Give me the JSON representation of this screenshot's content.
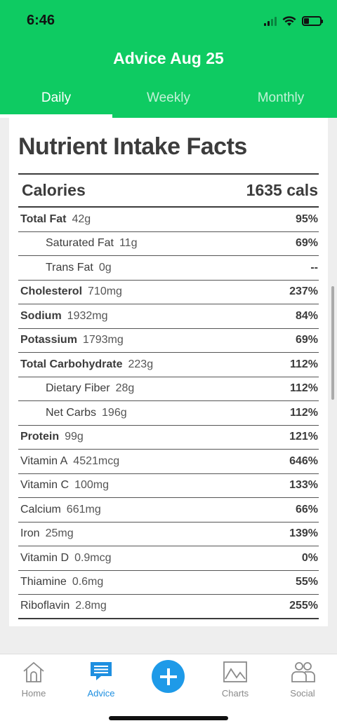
{
  "status": {
    "time": "6:46"
  },
  "header": {
    "title": "Advice Aug 25",
    "tabs": [
      {
        "label": "Daily",
        "active": true
      },
      {
        "label": "Weekly",
        "active": false
      },
      {
        "label": "Monthly",
        "active": false
      }
    ]
  },
  "card": {
    "title": "Nutrient Intake Facts",
    "calories": {
      "label": "Calories",
      "value": "1635 cals"
    },
    "rows": [
      {
        "name": "Total Fat",
        "amount": "42g",
        "percent": "95%",
        "style": "bold"
      },
      {
        "name": "Saturated Fat",
        "amount": "11g",
        "percent": "69%",
        "style": "sub"
      },
      {
        "name": "Trans Fat",
        "amount": "0g",
        "percent": "--",
        "style": "sub"
      },
      {
        "name": "Cholesterol",
        "amount": "710mg",
        "percent": "237%",
        "style": "bold"
      },
      {
        "name": "Sodium",
        "amount": "1932mg",
        "percent": "84%",
        "style": "bold"
      },
      {
        "name": "Potassium",
        "amount": "1793mg",
        "percent": "69%",
        "style": "bold"
      },
      {
        "name": "Total Carbohydrate",
        "amount": "223g",
        "percent": "112%",
        "style": "bold"
      },
      {
        "name": "Dietary Fiber",
        "amount": "28g",
        "percent": "112%",
        "style": "sub"
      },
      {
        "name": "Net Carbs",
        "amount": "196g",
        "percent": "112%",
        "style": "sub"
      },
      {
        "name": "Protein",
        "amount": "99g",
        "percent": "121%",
        "style": "bold"
      },
      {
        "name": "Vitamin A",
        "amount": "4521mcg",
        "percent": "646%",
        "style": "normal"
      },
      {
        "name": "Vitamin C",
        "amount": "100mg",
        "percent": "133%",
        "style": "normal"
      },
      {
        "name": "Calcium",
        "amount": "661mg",
        "percent": "66%",
        "style": "normal"
      },
      {
        "name": "Iron",
        "amount": "25mg",
        "percent": "139%",
        "style": "normal"
      },
      {
        "name": "Vitamin D",
        "amount": "0.9mcg",
        "percent": "0%",
        "style": "normal"
      },
      {
        "name": "Thiamine",
        "amount": "0.6mg",
        "percent": "55%",
        "style": "normal"
      },
      {
        "name": "Riboflavin",
        "amount": "2.8mg",
        "percent": "255%",
        "style": "normal"
      }
    ]
  },
  "nav": {
    "items": [
      {
        "label": "Home",
        "icon": "home-icon"
      },
      {
        "label": "Advice",
        "icon": "chat-icon",
        "active": true
      },
      {
        "label": "",
        "icon": "plus-icon"
      },
      {
        "label": "Charts",
        "icon": "chart-icon"
      },
      {
        "label": "Social",
        "icon": "people-icon"
      }
    ]
  },
  "colors": {
    "brand_green": "#0ecb62",
    "accent_blue": "#1e8fe0"
  }
}
